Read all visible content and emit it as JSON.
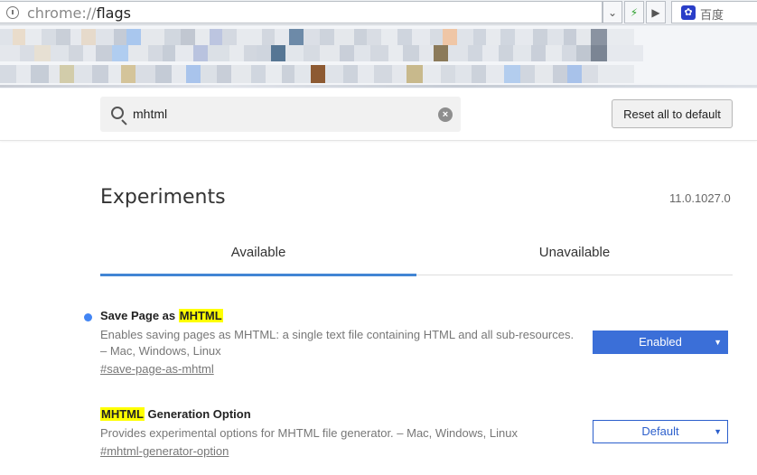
{
  "browser": {
    "url_scheme": "chrome://",
    "url_host": "flags",
    "search_engine": "百度"
  },
  "header": {
    "search_value": "mhtml",
    "reset_label": "Reset all to default"
  },
  "main": {
    "title": "Experiments",
    "version": "11.0.1027.0",
    "tabs": [
      {
        "label": "Available",
        "active": true
      },
      {
        "label": "Unavailable",
        "active": false
      }
    ]
  },
  "flags": [
    {
      "title_before": "Save Page as ",
      "highlight": "MHTML",
      "title_after": "",
      "description": "Enables saving pages as MHTML: a single text file containing HTML and all sub-resources. – Mac, Windows, Linux",
      "link": "#save-page-as-mhtml",
      "value": "Enabled",
      "modified": true
    },
    {
      "title_before": "",
      "highlight": "MHTML",
      "title_after": " Generation Option",
      "description": "Provides experimental options for MHTML file generator. – Mac, Windows, Linux",
      "link": "#mhtml-generator-option",
      "value": "Default",
      "modified": false
    }
  ],
  "colors": {
    "accent": "#4285d4",
    "enabled_select": "#3b6fd8",
    "highlight": "#ffff00"
  }
}
